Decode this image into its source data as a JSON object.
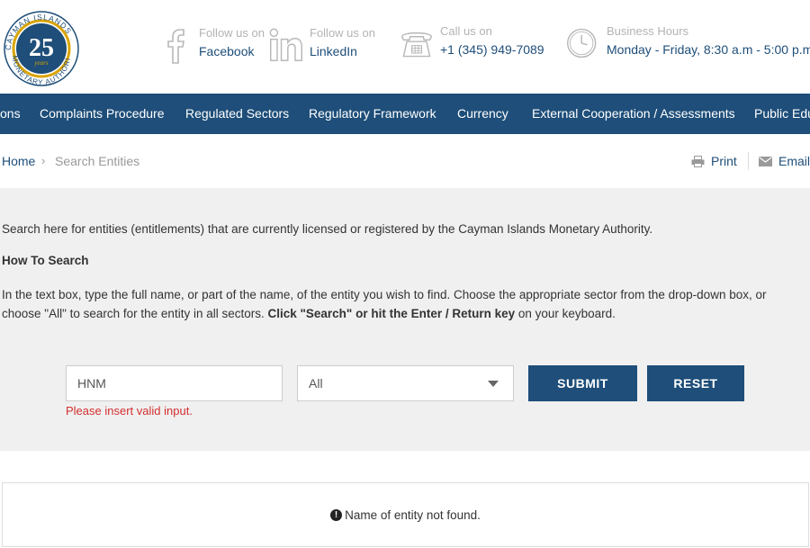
{
  "header": {
    "logo": {
      "ring_text": "CAYMAN ISLANDS MONETARY AUTHORITY",
      "number": "25",
      "script": "years"
    },
    "facebook": {
      "label": "Follow us on",
      "value": "Facebook"
    },
    "linkedin": {
      "label": "Follow us on",
      "value": "LinkedIn"
    },
    "phone": {
      "label": "Call us on",
      "value": "+1 (345) 949-7089"
    },
    "hours": {
      "label": "Business Hours",
      "value": "Monday - Friday, 8:30 a.m - 5:00 p.m"
    }
  },
  "nav": {
    "items": [
      {
        "label": "ons"
      },
      {
        "label": "Complaints Procedure"
      },
      {
        "label": "Regulated Sectors"
      },
      {
        "label": "Regulatory Framework"
      },
      {
        "label": "Currency"
      },
      {
        "label": "External Cooperation / Assessments"
      },
      {
        "label": "Public Edu"
      }
    ]
  },
  "breadcrumb": {
    "home": "Home",
    "separator": "›",
    "current": "Search Entities"
  },
  "tools": {
    "print": "Print",
    "email": "Email"
  },
  "content": {
    "intro": "Search here for entities (entitlements) that are currently licensed or registered by the Cayman Islands Monetary Authority.",
    "heading": "How To Search",
    "instructions_a": "In the text box, type the full name, or part of the name, of the entity you wish to find. Choose the appropriate sector from the drop-down box, or choose \"All\" to search for the entity in all sectors. ",
    "instructions_b": "Click \"Search\" or hit the Enter / Return key",
    "instructions_c": " on your keyboard."
  },
  "form": {
    "search_value": "HNM",
    "sector_selected": "All",
    "error": "Please insert valid input.",
    "submit_label": "SUBMIT",
    "reset_label": "RESET"
  },
  "result": {
    "message": "Name of entity not found.",
    "icon": "exclamation-circle-icon"
  },
  "colors": {
    "brand": "#1e4e79",
    "error": "#d32f2f",
    "panel": "#f0f0f0"
  }
}
